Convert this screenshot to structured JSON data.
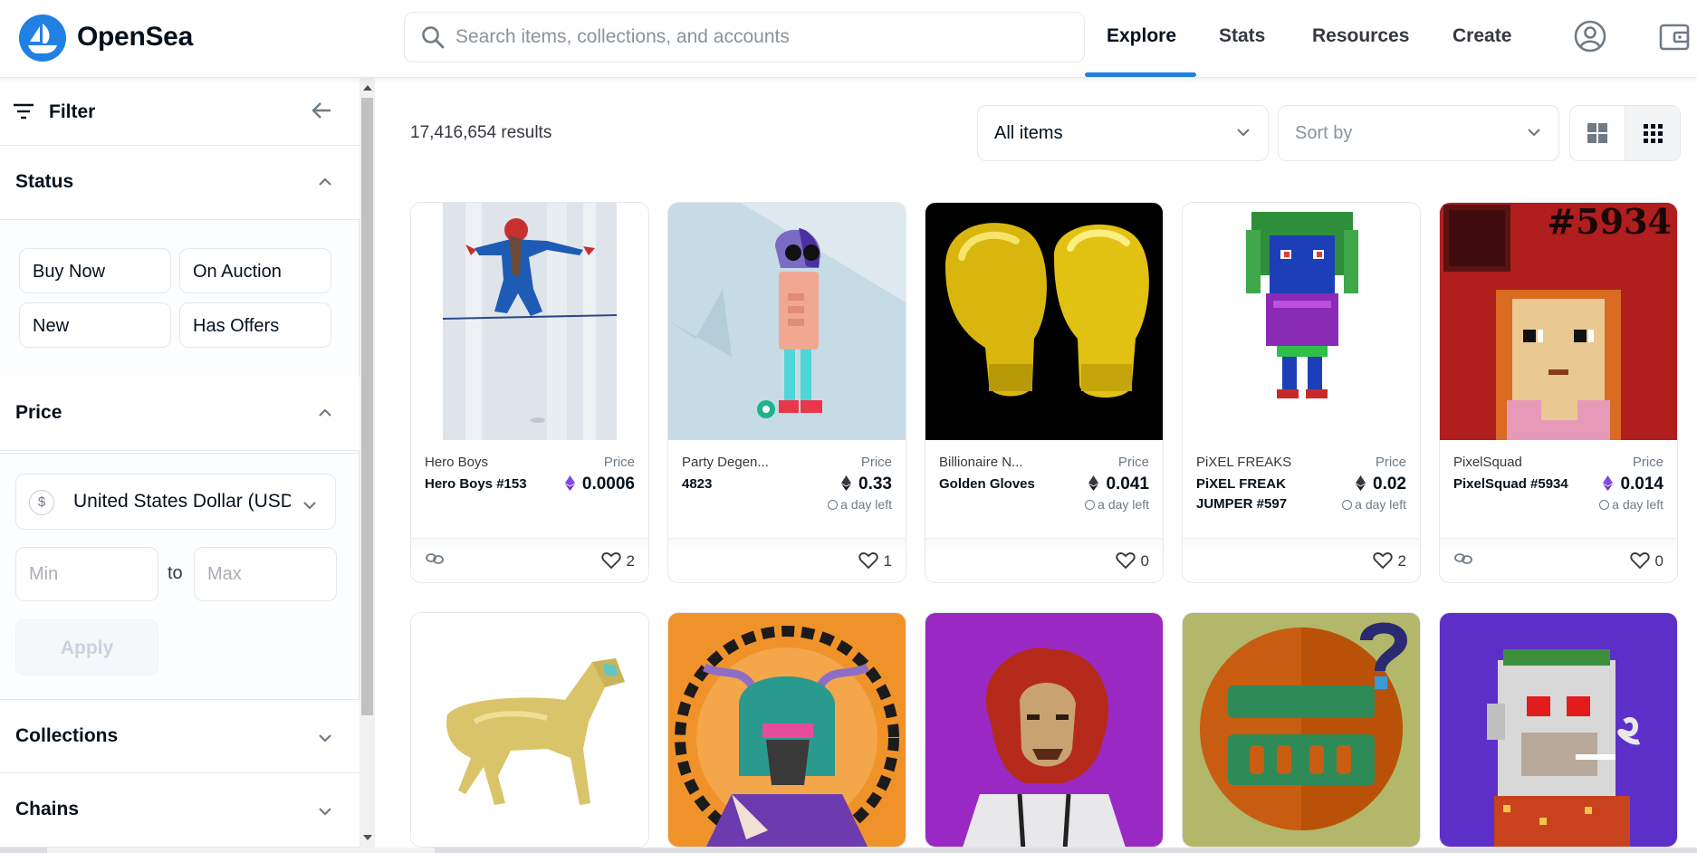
{
  "header": {
    "brand": "OpenSea",
    "search_placeholder": "Search items, collections, and accounts",
    "nav": {
      "explore": "Explore",
      "stats": "Stats",
      "resources": "Resources",
      "create": "Create"
    }
  },
  "sidebar": {
    "filter_label": "Filter",
    "status_title": "Status",
    "status_options": [
      "Buy Now",
      "On Auction",
      "New",
      "Has Offers"
    ],
    "price_title": "Price",
    "currency_symbol": "$",
    "currency": "United States Dollar (USD)",
    "min_placeholder": "Min",
    "max_placeholder": "Max",
    "to_label": "to",
    "apply_label": "Apply",
    "collections_title": "Collections",
    "chains_title": "Chains"
  },
  "main": {
    "results": "17,416,654 results",
    "items_filter": "All items",
    "sort_placeholder": "Sort by"
  },
  "cards": [
    {
      "collection": "Hero Boys",
      "name": "Hero Boys #153",
      "price_label": "Price",
      "price": "0.0006",
      "currency": "weth",
      "time_left": "",
      "favorites": "2",
      "linked": true
    },
    {
      "collection": "Party Degen...",
      "name": "4823",
      "price_label": "Price",
      "price": "0.33",
      "currency": "eth",
      "time_left": "a day left",
      "favorites": "1",
      "linked": false
    },
    {
      "collection": "Billionaire N...",
      "name": "Golden Gloves",
      "price_label": "Price",
      "price": "0.041",
      "currency": "eth",
      "time_left": "a day left",
      "favorites": "0",
      "linked": false
    },
    {
      "collection": "PiXEL FREAKS",
      "name": "PiXEL FREAK JUMPER #597",
      "price_label": "Price",
      "price": "0.02",
      "currency": "eth",
      "time_left": "a day left",
      "favorites": "2",
      "linked": false
    },
    {
      "collection": "PixelSquad",
      "name": "PixelSquad #5934",
      "price_label": "Price",
      "price": "0.014",
      "currency": "weth",
      "time_left": "a day left",
      "favorites": "0",
      "linked": true,
      "image_text": "#5934"
    }
  ],
  "colors": {
    "accent": "#2081e2",
    "text": "#04111d",
    "muted": "#707a83",
    "border": "#e5e8eb"
  }
}
